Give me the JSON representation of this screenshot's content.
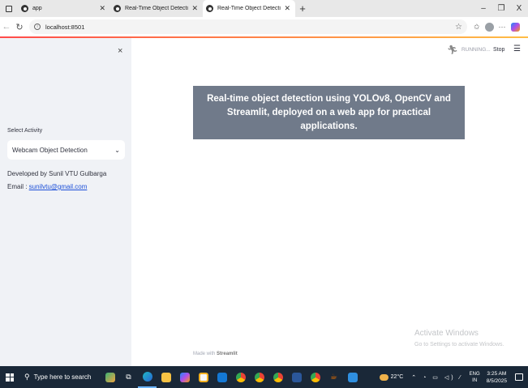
{
  "browser": {
    "tabs": [
      {
        "title": "app",
        "active": false
      },
      {
        "title": "Real-Time Object Detection",
        "active": false
      },
      {
        "title": "Real-Time Object Detection",
        "active": true
      }
    ],
    "url": "localhost:8501",
    "window_controls": {
      "minimize": "–",
      "maximize": "❐",
      "close": "X"
    }
  },
  "sidebar": {
    "close": "×",
    "select_label": "Select Activity",
    "select_value": "Webcam Object Detection",
    "developer": "Developed by Sunil VTU Gulbarga",
    "email_prefix": "Email : ",
    "email": "sunilvtu@gmail.com"
  },
  "header": {
    "status": "RUNNING...",
    "stop": "Stop"
  },
  "main": {
    "banner": "Real-time object detection using YOLOv8, OpenCV and Streamlit, deployed on a web app for practical applications.",
    "made_with_prefix": "Made with ",
    "made_with_brand": "Streamlit"
  },
  "watermark": {
    "line1": "Activate Windows",
    "line2": "Go to Settings to activate Windows."
  },
  "taskbar": {
    "search_placeholder": "Type here to search",
    "temperature": "22°C",
    "lang_line1": "ENG",
    "lang_line2": "IN",
    "time": "3:25 AM",
    "date": "8/5/2025",
    "icons": [
      "task-view",
      "edge",
      "file-explorer",
      "copilot",
      "store",
      "outlook",
      "chrome",
      "chrome",
      "chrome",
      "word",
      "chrome",
      "java",
      "vscode"
    ]
  }
}
